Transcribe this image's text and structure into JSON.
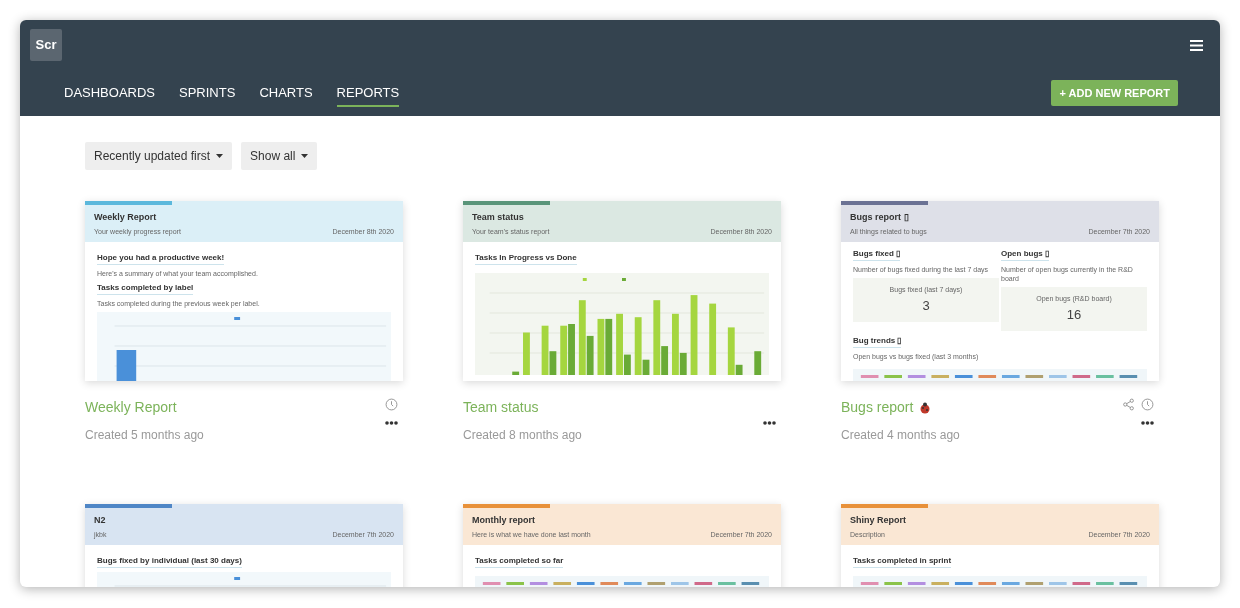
{
  "logo": "Scr",
  "nav": [
    {
      "label": "DASHBOARDS",
      "selected": false
    },
    {
      "label": "SPRINTS",
      "selected": false
    },
    {
      "label": "CHARTS",
      "selected": false
    },
    {
      "label": "REPORTS",
      "selected": true
    }
  ],
  "add_button": "+ ADD NEW REPORT",
  "filters": [
    "Recently updated first",
    "Show all"
  ],
  "reports": [
    {
      "color": "#5bb8dc",
      "title": "Weekly Report",
      "subtitle": "Your weekly progress report",
      "date": "December 8th 2020",
      "blocks": [
        {
          "kind": "heading",
          "text": "Hope you had a productive week!"
        },
        {
          "kind": "text",
          "text": "Here's a summary of what your team accomplished."
        },
        {
          "kind": "heading",
          "text": "Tasks completed by label"
        },
        {
          "kind": "text",
          "text": "Tasks completed during the previous week per label."
        },
        {
          "kind": "bar_chart"
        }
      ],
      "name": "Weekly Report",
      "created": "Created 5 months ago",
      "share": false,
      "history": true
    },
    {
      "color": "#5a957a",
      "title": "Team status",
      "subtitle": "Your team's status report",
      "date": "December 8th 2020",
      "blocks": [
        {
          "kind": "heading",
          "text": "Tasks In Progress vs Done"
        },
        {
          "kind": "grouped_chart"
        }
      ],
      "name": "Team status",
      "created": "Created 8 months ago",
      "share": false,
      "history": false
    },
    {
      "color": "#6b7294",
      "title": "Bugs report ▯",
      "subtitle": "All things related to bugs",
      "date": "December 7th 2020",
      "blocks": [
        {
          "kind": "stats",
          "items": [
            {
              "heading": "Bugs fixed ▯",
              "text": "Number of bugs fixed during the last 7 days",
              "label": "Bugs fixed (last 7 days)",
              "value": "3"
            },
            {
              "heading": "Open bugs ▯",
              "text": "Number of open bugs currently in the R&D board",
              "label": "Open bugs (R&D board)",
              "value": "16"
            }
          ]
        },
        {
          "kind": "heading",
          "text": "Bug trends ▯"
        },
        {
          "kind": "text",
          "text": "Open bugs vs bugs fixed (last 3 months)"
        },
        {
          "kind": "legend_chart"
        }
      ],
      "name": "Bugs report",
      "created": "Created 4 months ago",
      "share": true,
      "history": true,
      "bug_emoji": true
    },
    {
      "color": "#4f86c6",
      "title": "N2",
      "subtitle": "jkbk",
      "date": "December 7th 2020",
      "blocks": [
        {
          "kind": "heading",
          "text": "Bugs fixed by individual (last 30 days)"
        },
        {
          "kind": "bar_chart"
        }
      ]
    },
    {
      "color": "#e8913a",
      "title": "Monthly report",
      "subtitle": "Here is what we have done last month",
      "date": "December 7th 2020",
      "blocks": [
        {
          "kind": "heading",
          "text": "Tasks completed so far"
        },
        {
          "kind": "legend_chart"
        }
      ]
    },
    {
      "color": "#e8913a",
      "title": "Shiny Report",
      "subtitle": "Description",
      "date": "December 7th 2020",
      "blocks": [
        {
          "kind": "heading",
          "text": "Tasks completed in sprint"
        },
        {
          "kind": "legend_chart"
        }
      ]
    }
  ]
}
